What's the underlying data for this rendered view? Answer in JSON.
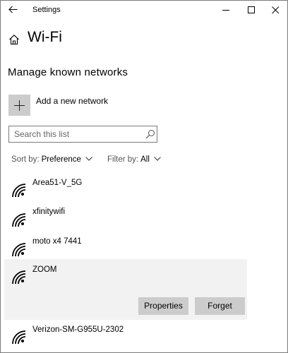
{
  "window": {
    "title": "Settings",
    "controls": {
      "minimize": "minimize-icon",
      "maximize": "maximize-icon",
      "close": "close-icon"
    },
    "back": "back-arrow-icon"
  },
  "header": {
    "home_icon": "home-icon",
    "title": "Wi-Fi"
  },
  "section": {
    "title": "Manage known networks"
  },
  "add_network": {
    "icon": "plus-icon",
    "label": "Add a new network"
  },
  "search": {
    "placeholder": "Search this list",
    "value": "",
    "icon": "search-icon"
  },
  "sort": {
    "label": "Sort by:",
    "value": "Preference"
  },
  "filter": {
    "label": "Filter by:",
    "value": "All"
  },
  "networks": [
    {
      "name": "Area51-V_5G",
      "icon": "wifi-icon",
      "expanded": false
    },
    {
      "name": "xfinitywifi",
      "icon": "wifi-icon",
      "expanded": false
    },
    {
      "name": "moto x4 7441",
      "icon": "wifi-icon",
      "expanded": false
    },
    {
      "name": "ZOOM",
      "icon": "wifi-icon",
      "expanded": true,
      "actions": {
        "properties": "Properties",
        "forget": "Forget"
      }
    },
    {
      "name": "Verizon-SM-G955U-2302",
      "icon": "wifi-icon",
      "expanded": false
    }
  ],
  "colors": {
    "button_gray": "#cccccc",
    "selected_row": "#f2f2f2",
    "window_border": "#7a7a7a"
  }
}
